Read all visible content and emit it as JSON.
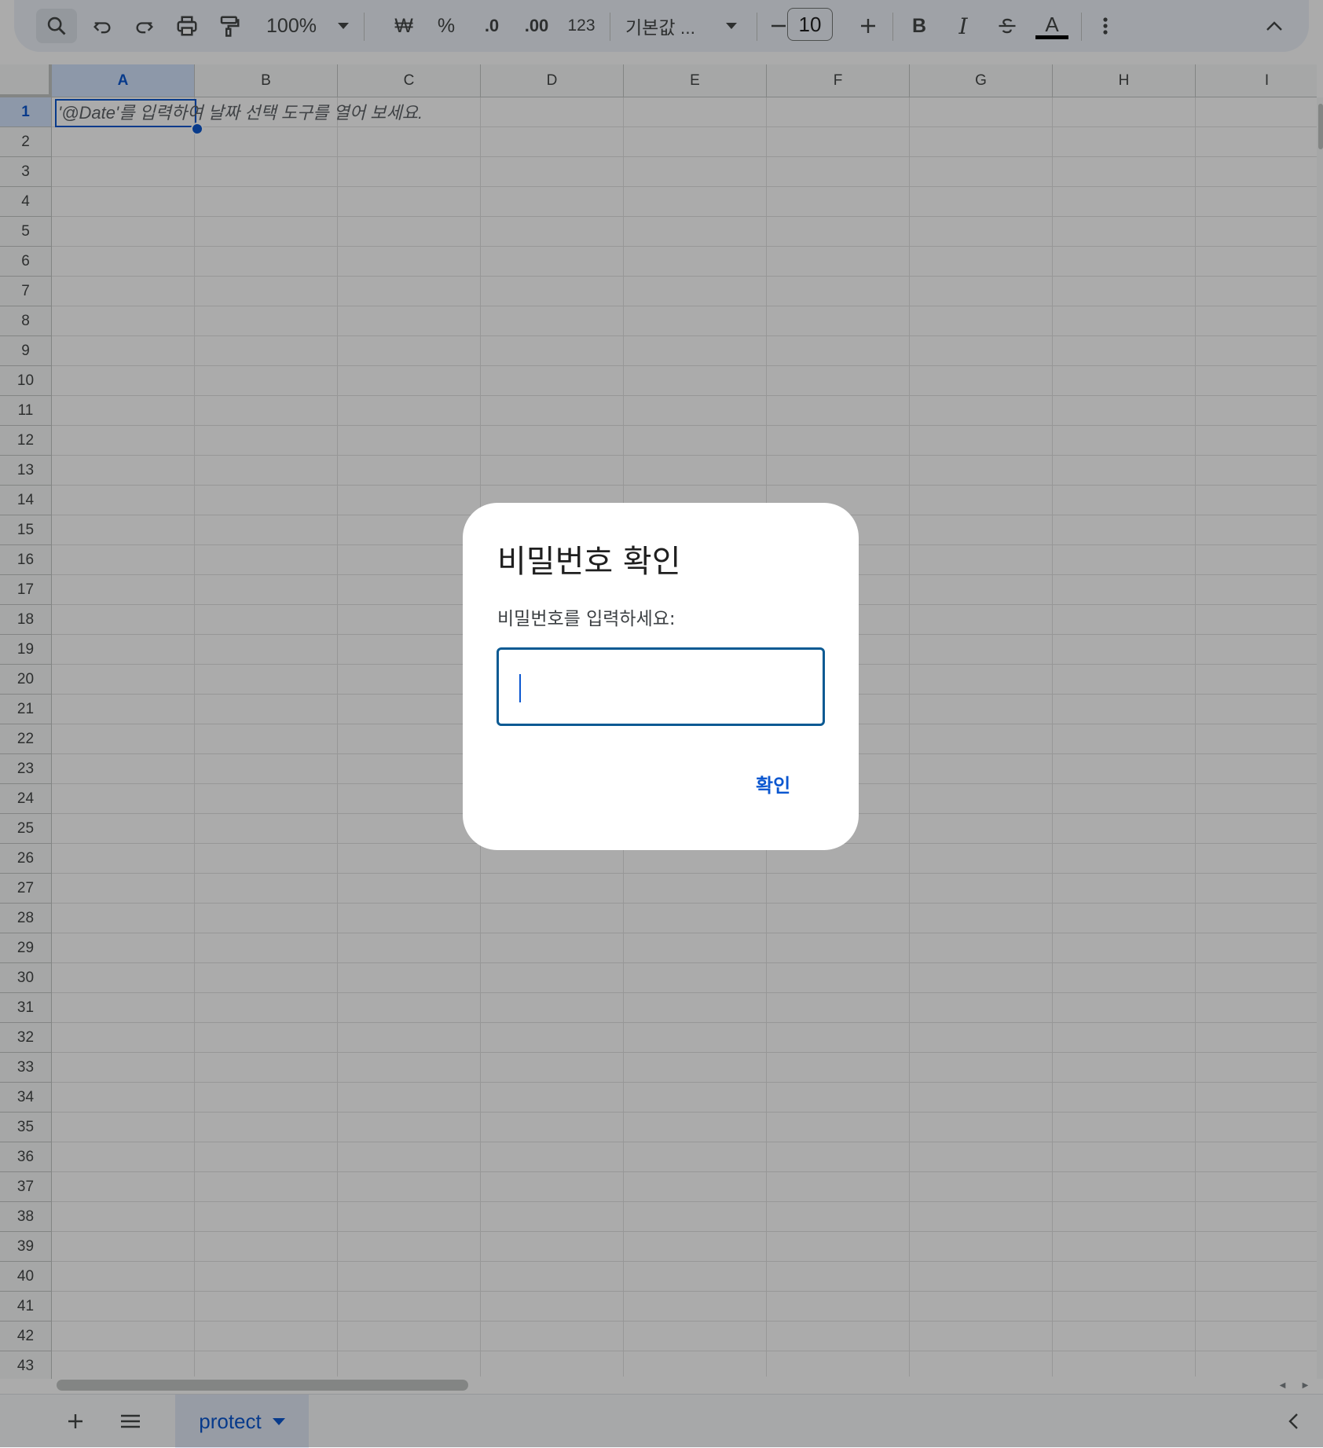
{
  "toolbar": {
    "zoom": "100%",
    "currency_symbol": "₩",
    "percent_symbol": "%",
    "decrease_decimal": ".0",
    "increase_decimal": ".00",
    "number_format": "123",
    "font_family": "기본값 ...",
    "font_size": "10",
    "bold_label": "B",
    "italic_label": "I",
    "text_color_label": "A",
    "icons": [
      "search-icon",
      "undo-icon",
      "redo-icon",
      "print-icon",
      "paint-format-icon",
      "chevron-down-icon",
      "minus-icon",
      "plus-icon",
      "strikethrough-icon",
      "more-vert-icon",
      "chevron-up-icon"
    ]
  },
  "grid": {
    "columns": [
      "A",
      "B",
      "C",
      "D",
      "E",
      "F",
      "G",
      "H",
      "I"
    ],
    "selected_column": "A",
    "rows": [
      "1",
      "2",
      "3",
      "4",
      "5",
      "6",
      "7",
      "8",
      "9",
      "10",
      "11",
      "12",
      "13",
      "14",
      "15",
      "16",
      "17",
      "18",
      "19",
      "20",
      "21",
      "22",
      "23",
      "24",
      "25",
      "26",
      "27",
      "28",
      "29",
      "30",
      "31",
      "32",
      "33",
      "34",
      "35",
      "36",
      "37",
      "38",
      "39",
      "40",
      "41",
      "42",
      "43"
    ],
    "selected_row": "1",
    "cell_a1_hint": "'@Date'를 입력하여 날짜 선택 도구를 열어 보세요."
  },
  "sheets": {
    "active_tab": "protect"
  },
  "dialog": {
    "title": "비밀번호 확인",
    "label": "비밀번호를 입력하세요:",
    "input_value": "",
    "ok_button": "확인"
  },
  "colors": {
    "accent": "#0b57d0",
    "input_border": "#0b5a93",
    "overlay": "rgba(0,0,0,0.33)"
  }
}
